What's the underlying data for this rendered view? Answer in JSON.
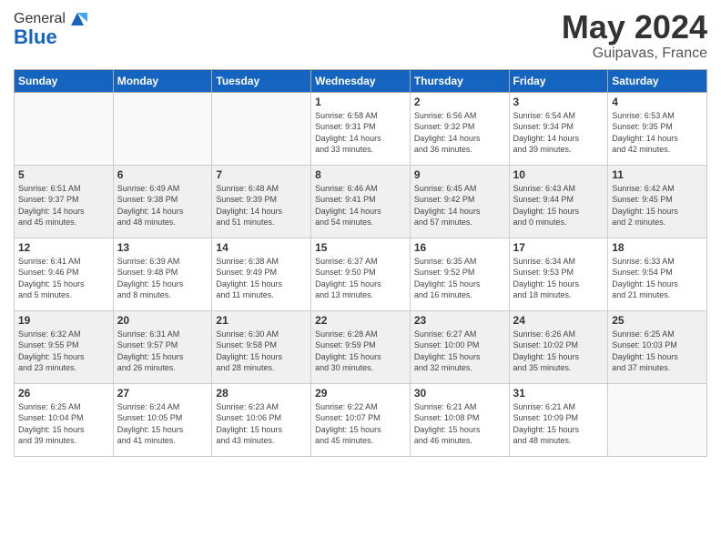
{
  "header": {
    "logo_general": "General",
    "logo_blue": "Blue",
    "month_title": "May 2024",
    "location": "Guipavas, France"
  },
  "weekdays": [
    "Sunday",
    "Monday",
    "Tuesday",
    "Wednesday",
    "Thursday",
    "Friday",
    "Saturday"
  ],
  "weeks": [
    [
      {
        "day": "",
        "info": ""
      },
      {
        "day": "",
        "info": ""
      },
      {
        "day": "",
        "info": ""
      },
      {
        "day": "1",
        "info": "Sunrise: 6:58 AM\nSunset: 9:31 PM\nDaylight: 14 hours\nand 33 minutes."
      },
      {
        "day": "2",
        "info": "Sunrise: 6:56 AM\nSunset: 9:32 PM\nDaylight: 14 hours\nand 36 minutes."
      },
      {
        "day": "3",
        "info": "Sunrise: 6:54 AM\nSunset: 9:34 PM\nDaylight: 14 hours\nand 39 minutes."
      },
      {
        "day": "4",
        "info": "Sunrise: 6:53 AM\nSunset: 9:35 PM\nDaylight: 14 hours\nand 42 minutes."
      }
    ],
    [
      {
        "day": "5",
        "info": "Sunrise: 6:51 AM\nSunset: 9:37 PM\nDaylight: 14 hours\nand 45 minutes."
      },
      {
        "day": "6",
        "info": "Sunrise: 6:49 AM\nSunset: 9:38 PM\nDaylight: 14 hours\nand 48 minutes."
      },
      {
        "day": "7",
        "info": "Sunrise: 6:48 AM\nSunset: 9:39 PM\nDaylight: 14 hours\nand 51 minutes."
      },
      {
        "day": "8",
        "info": "Sunrise: 6:46 AM\nSunset: 9:41 PM\nDaylight: 14 hours\nand 54 minutes."
      },
      {
        "day": "9",
        "info": "Sunrise: 6:45 AM\nSunset: 9:42 PM\nDaylight: 14 hours\nand 57 minutes."
      },
      {
        "day": "10",
        "info": "Sunrise: 6:43 AM\nSunset: 9:44 PM\nDaylight: 15 hours\nand 0 minutes."
      },
      {
        "day": "11",
        "info": "Sunrise: 6:42 AM\nSunset: 9:45 PM\nDaylight: 15 hours\nand 2 minutes."
      }
    ],
    [
      {
        "day": "12",
        "info": "Sunrise: 6:41 AM\nSunset: 9:46 PM\nDaylight: 15 hours\nand 5 minutes."
      },
      {
        "day": "13",
        "info": "Sunrise: 6:39 AM\nSunset: 9:48 PM\nDaylight: 15 hours\nand 8 minutes."
      },
      {
        "day": "14",
        "info": "Sunrise: 6:38 AM\nSunset: 9:49 PM\nDaylight: 15 hours\nand 11 minutes."
      },
      {
        "day": "15",
        "info": "Sunrise: 6:37 AM\nSunset: 9:50 PM\nDaylight: 15 hours\nand 13 minutes."
      },
      {
        "day": "16",
        "info": "Sunrise: 6:35 AM\nSunset: 9:52 PM\nDaylight: 15 hours\nand 16 minutes."
      },
      {
        "day": "17",
        "info": "Sunrise: 6:34 AM\nSunset: 9:53 PM\nDaylight: 15 hours\nand 18 minutes."
      },
      {
        "day": "18",
        "info": "Sunrise: 6:33 AM\nSunset: 9:54 PM\nDaylight: 15 hours\nand 21 minutes."
      }
    ],
    [
      {
        "day": "19",
        "info": "Sunrise: 6:32 AM\nSunset: 9:55 PM\nDaylight: 15 hours\nand 23 minutes."
      },
      {
        "day": "20",
        "info": "Sunrise: 6:31 AM\nSunset: 9:57 PM\nDaylight: 15 hours\nand 26 minutes."
      },
      {
        "day": "21",
        "info": "Sunrise: 6:30 AM\nSunset: 9:58 PM\nDaylight: 15 hours\nand 28 minutes."
      },
      {
        "day": "22",
        "info": "Sunrise: 6:28 AM\nSunset: 9:59 PM\nDaylight: 15 hours\nand 30 minutes."
      },
      {
        "day": "23",
        "info": "Sunrise: 6:27 AM\nSunset: 10:00 PM\nDaylight: 15 hours\nand 32 minutes."
      },
      {
        "day": "24",
        "info": "Sunrise: 6:26 AM\nSunset: 10:02 PM\nDaylight: 15 hours\nand 35 minutes."
      },
      {
        "day": "25",
        "info": "Sunrise: 6:25 AM\nSunset: 10:03 PM\nDaylight: 15 hours\nand 37 minutes."
      }
    ],
    [
      {
        "day": "26",
        "info": "Sunrise: 6:25 AM\nSunset: 10:04 PM\nDaylight: 15 hours\nand 39 minutes."
      },
      {
        "day": "27",
        "info": "Sunrise: 6:24 AM\nSunset: 10:05 PM\nDaylight: 15 hours\nand 41 minutes."
      },
      {
        "day": "28",
        "info": "Sunrise: 6:23 AM\nSunset: 10:06 PM\nDaylight: 15 hours\nand 43 minutes."
      },
      {
        "day": "29",
        "info": "Sunrise: 6:22 AM\nSunset: 10:07 PM\nDaylight: 15 hours\nand 45 minutes."
      },
      {
        "day": "30",
        "info": "Sunrise: 6:21 AM\nSunset: 10:08 PM\nDaylight: 15 hours\nand 46 minutes."
      },
      {
        "day": "31",
        "info": "Sunrise: 6:21 AM\nSunset: 10:09 PM\nDaylight: 15 hours\nand 48 minutes."
      },
      {
        "day": "",
        "info": ""
      }
    ]
  ]
}
